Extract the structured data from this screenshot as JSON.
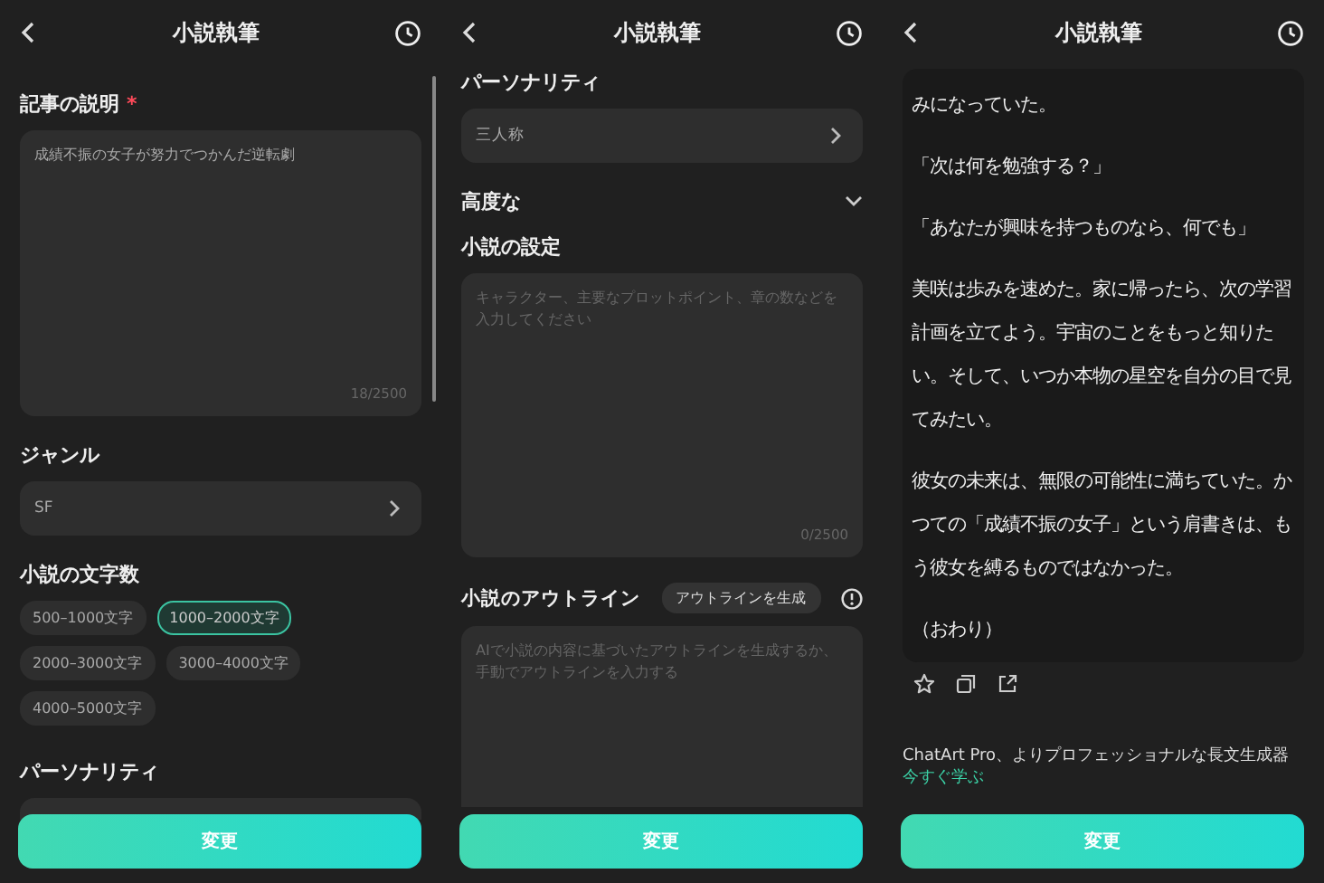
{
  "screens": [
    {
      "title": "小説執筆",
      "description": {
        "label": "記事の説明",
        "required_mark": "*",
        "value": "成績不振の女子が努力でつかんだ逆転劇",
        "counter": "18/2500"
      },
      "genre": {
        "label": "ジャンル",
        "value": "SF"
      },
      "length": {
        "label": "小説の文字数",
        "options": [
          {
            "label": "500–1000文字",
            "selected": false
          },
          {
            "label": "1000–2000文字",
            "selected": true
          },
          {
            "label": "2000–3000文字",
            "selected": false
          },
          {
            "label": "3000–4000文字",
            "selected": false
          },
          {
            "label": "4000–5000文字",
            "selected": false
          }
        ]
      },
      "personality": {
        "label": "パーソナリティ"
      },
      "button": "変更"
    },
    {
      "title": "小説執筆",
      "personality": {
        "label": "パーソナリティ",
        "value": "三人称"
      },
      "advanced": {
        "label": "高度な",
        "expanded": true
      },
      "setting": {
        "label": "小説の設定",
        "placeholder": "キャラクター、主要なプロットポイント、章の数などを入力してください",
        "counter": "0/2500"
      },
      "outline": {
        "label": "小説のアウトライン",
        "generate_button": "アウトラインを生成",
        "placeholder": "AIで小説の内容に基づいたアウトラインを生成するか、手動でアウトラインを入力する"
      },
      "button": "変更"
    },
    {
      "title": "小説執筆",
      "story": [
        "みになっていた。",
        "「次は何を勉強する？」",
        "「あなたが興味を持つものなら、何でも」",
        "美咲は歩みを速めた。家に帰ったら、次の学習計画を立てよう。宇宙のことをもっと知りたい。そして、いつか本物の星空を自分の目で見てみたい。",
        "彼女の未来は、無限の可能性に満ちていた。かつての「成績不振の女子」という肩書きは、もう彼女を縛るものではなかった。",
        "（おわり）"
      ],
      "promo": {
        "text": "ChatArt Pro、よりプロフェッショナルな長文生成器",
        "link": "今すぐ学ぶ"
      },
      "button": "変更"
    }
  ]
}
